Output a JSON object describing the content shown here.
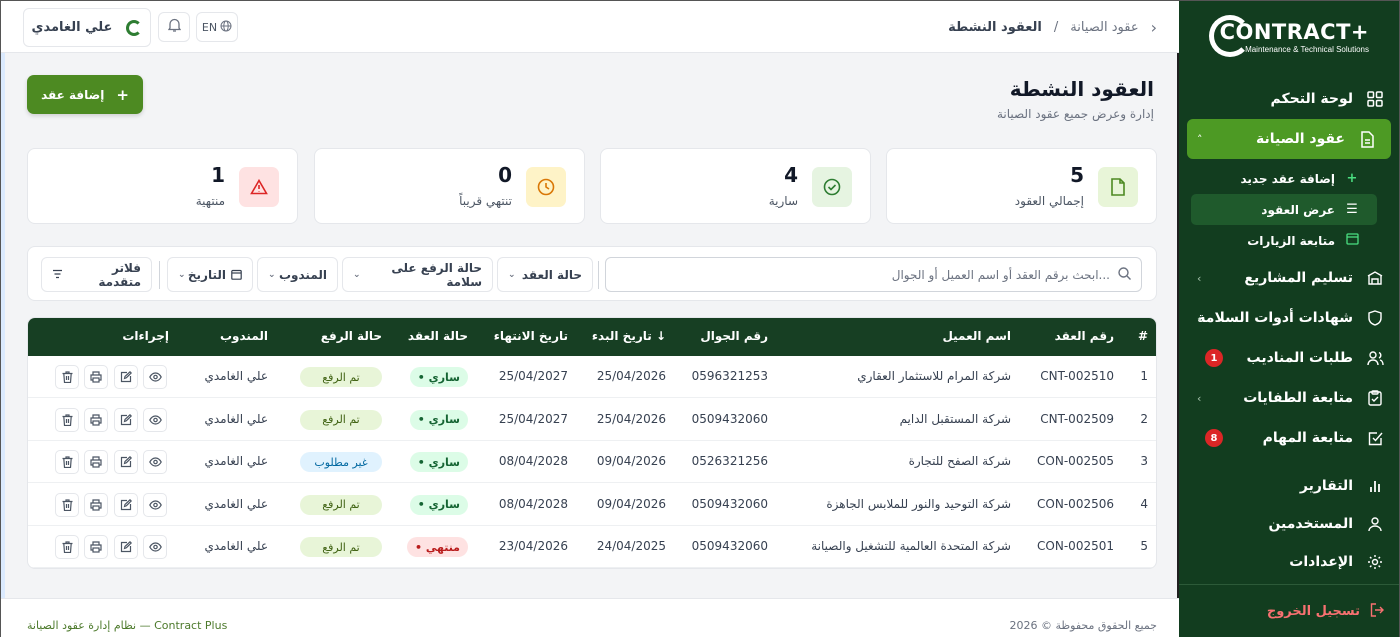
{
  "brand": {
    "name": "CONTRACT+",
    "tagline": "Maintenance & Technical Solutions",
    "accent": "#4d9a24",
    "sidebar_bg": "#123d1f"
  },
  "sidebar": {
    "items": [
      {
        "label": "لوحة التحكم",
        "icon": "grid-icon"
      },
      {
        "label": "عقود الصيانة",
        "icon": "document-icon"
      },
      {
        "label": "تسليم المشاريع",
        "icon": "building-icon"
      },
      {
        "label": "شهادات أدوات السلامة",
        "icon": "shield-icon"
      },
      {
        "label": "طلبات المناديب",
        "icon": "users-icon",
        "badge": "1"
      },
      {
        "label": "متابعة الطفايات",
        "icon": "clipboard-icon"
      },
      {
        "label": "متابعة المهام",
        "icon": "checkbox-icon",
        "badge": "8"
      },
      {
        "label": "التقارير",
        "icon": "bar-chart-icon"
      },
      {
        "label": "المستخدمين",
        "icon": "user-icon"
      },
      {
        "label": "الإعدادات",
        "icon": "gear-icon"
      }
    ],
    "sub": [
      {
        "label": "إضافة عقد جديد",
        "icon": "plus-icon"
      },
      {
        "label": "عرض العقود",
        "icon": "list-icon"
      },
      {
        "label": "متابعة الزيارات",
        "icon": "calendar-icon"
      }
    ],
    "logout": "تسجيل الخروج"
  },
  "topbar": {
    "crumb_parent": "عقود الصيانة",
    "crumb_sep": "/",
    "crumb_current": "العقود النشطة",
    "user": "علي الغامدي",
    "lang": "EN"
  },
  "header": {
    "title": "العقود النشطة",
    "subtitle": "إدارة وعرض جميع عقود الصيانة",
    "add_button": "إضافة عقد"
  },
  "stats": [
    {
      "value": "5",
      "label": "إجمالي العقود",
      "icon": "file-icon"
    },
    {
      "value": "4",
      "label": "سارية",
      "icon": "check-circle-icon"
    },
    {
      "value": "0",
      "label": "تنتهي قريباً",
      "icon": "clock-icon"
    },
    {
      "value": "1",
      "label": "منتهية",
      "icon": "warning-icon"
    }
  ],
  "filters": {
    "search_placeholder": "ابحث برقم العقد أو اسم العميل أو الجوال...",
    "status": "حالة العقد",
    "upload": "حالة الرفع على سلامة",
    "rep": "المندوب",
    "date": "التاريخ",
    "advanced": "فلاتر متقدمة"
  },
  "table": {
    "headers": {
      "idx": "#",
      "no": "رقم العقد",
      "client": "اسم العميل",
      "phone": "رقم الجوال",
      "start": "تاريخ البدء ↓",
      "end": "تاريخ الانتهاء",
      "status": "حالة العقد",
      "upload": "حالة الرفع",
      "rep": "المندوب",
      "actions": "إجراءات"
    },
    "rows": [
      {
        "idx": "1",
        "no": "CNT-002510",
        "client": "شركة المرام للاستثمار العقاري",
        "phone": "0596321253",
        "start": "25/04/2026",
        "end": "25/04/2027",
        "status": "• ساري",
        "upload": "تم الرفع",
        "rep": "علي الغامدي"
      },
      {
        "idx": "2",
        "no": "CNT-002509",
        "client": "شركة المستقبل الدايم",
        "phone": "0509432060",
        "start": "25/04/2026",
        "end": "25/04/2027",
        "status": "• ساري",
        "upload": "تم الرفع",
        "rep": "علي الغامدي"
      },
      {
        "idx": "3",
        "no": "CON-002505",
        "client": "شركة الصفح للتجارة",
        "phone": "0526321256",
        "start": "09/04/2026",
        "end": "08/04/2028",
        "status": "• ساري",
        "upload": "غير مطلوب",
        "rep": "علي الغامدي"
      },
      {
        "idx": "4",
        "no": "CON-002506",
        "client": "شركة التوحيد والنور للملابس الجاهزة",
        "phone": "0509432060",
        "start": "09/04/2026",
        "end": "08/04/2028",
        "status": "• ساري",
        "upload": "تم الرفع",
        "rep": "علي الغامدي"
      },
      {
        "idx": "5",
        "no": "CON-002501",
        "client": "شركة المتحدة العالمية للتشغيل والصيانة",
        "phone": "0509432060",
        "start": "24/04/2025",
        "end": "23/04/2026",
        "status": "• منتهي",
        "upload": "تم الرفع",
        "rep": "علي الغامدي"
      }
    ]
  },
  "footer": {
    "rights": "جميع الحقوق محفوظة © 2026",
    "system": "نظام إدارة عقود الصيانة — Contract Plus"
  }
}
